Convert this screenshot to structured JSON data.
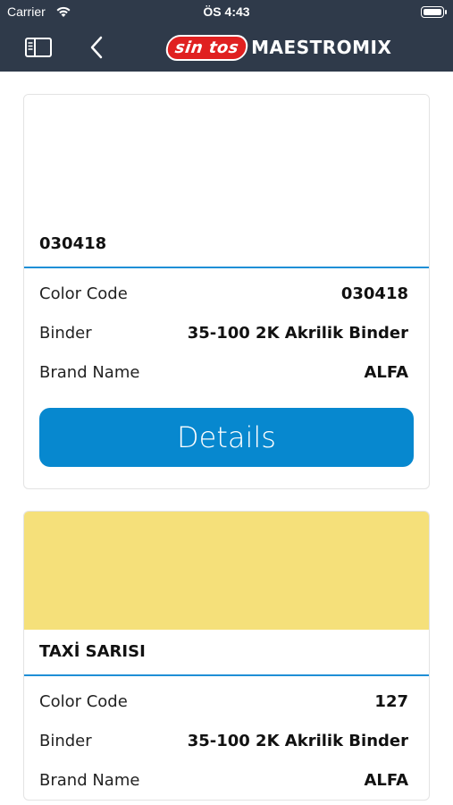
{
  "status_bar": {
    "carrier": "Carrier",
    "time": "ÖS 4:43"
  },
  "nav": {
    "logo_badge": "sin tos",
    "logo_text": "MAESTROMIX",
    "brand_color": "#e02020",
    "bar_color": "#2f3a4a",
    "icons": [
      "sidebar-icon",
      "back-icon"
    ]
  },
  "labels": {
    "color_code": "Color Code",
    "binder": "Binder",
    "brand_name": "Brand Name",
    "details_button": "Details"
  },
  "cards": [
    {
      "swatch_color": "#ffffff",
      "title": "030418",
      "color_code": "030418",
      "binder": "35-100 2K Akrilik Binder",
      "brand_name": "ALFA"
    },
    {
      "swatch_color": "#f5e07a",
      "title": "TAXİ SARISI",
      "color_code": "127",
      "binder": "35-100 2K Akrilik Binder",
      "brand_name": "ALFA"
    }
  ],
  "accent_color": "#0788cf"
}
